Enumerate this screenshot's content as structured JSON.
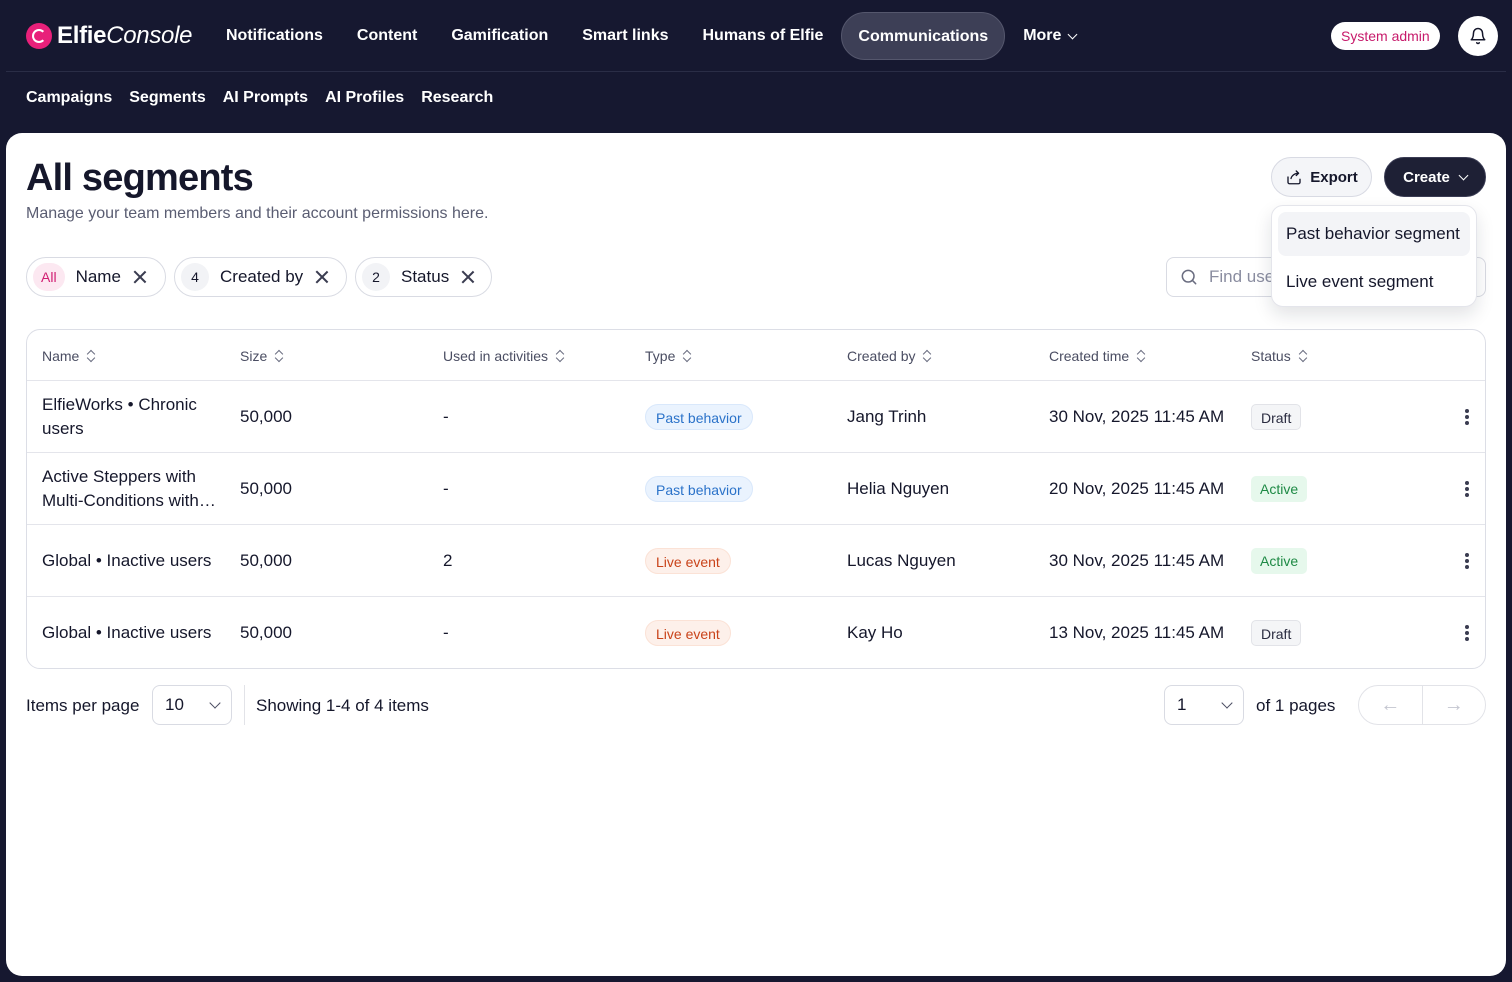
{
  "app": {
    "logo_bold": "Elfie",
    "logo_italic": "Console",
    "nav": [
      "Notifications",
      "Content",
      "Gamification",
      "Smart links",
      "Humans of Elfie",
      "Communications"
    ],
    "nav_active": "Communications",
    "nav_more": "More",
    "role": "System admin",
    "subnav": [
      "Campaigns",
      "Segments",
      "AI Prompts",
      "AI Profiles",
      "Research"
    ]
  },
  "page": {
    "title": "All segments",
    "subtitle": "Manage your team members and their account permissions here.",
    "export_label": "Export",
    "create_label": "Create",
    "create_menu": [
      "Past behavior segment",
      "Live event segment"
    ]
  },
  "filters": [
    {
      "badge": "All",
      "label": "Name"
    },
    {
      "badge": "4",
      "label": "Created by"
    },
    {
      "badge": "2",
      "label": "Status"
    }
  ],
  "search": {
    "placeholder": "Find users"
  },
  "table": {
    "headers": [
      "Name",
      "Size",
      "Used in activities",
      "Type",
      "Created by",
      "Created time",
      "Status"
    ],
    "rows": [
      {
        "name": "ElfieWorks • Chronic users",
        "size": "50,000",
        "used": "-",
        "type": "Past behavior",
        "created_by": "Jang Trinh",
        "created_time": "30 Nov, 2025 11:45 AM",
        "status": "Draft"
      },
      {
        "name": "Active Steppers with Multi-Conditions with filters",
        "size": "50,000",
        "used": "-",
        "type": "Past behavior",
        "created_by": "Helia Nguyen",
        "created_time": "20 Nov, 2025 11:45 AM",
        "status": "Active"
      },
      {
        "name": "Global • Inactive users",
        "size": "50,000",
        "used": "2",
        "type": "Live event",
        "created_by": "Lucas Nguyen",
        "created_time": "30 Nov, 2025 11:45 AM",
        "status": "Active"
      },
      {
        "name": "Global • Inactive users",
        "size": "50,000",
        "used": "-",
        "type": "Live event",
        "created_by": "Kay Ho",
        "created_time": "13 Nov, 2025 11:45 AM",
        "status": "Draft"
      }
    ]
  },
  "pagination": {
    "items_per_page_label": "Items per page",
    "items_per_page": "10",
    "showing": "Showing 1-4 of 4 items",
    "page": "1",
    "of_pages": "of 1 pages",
    "prev": "←",
    "next": "→"
  },
  "colors": {
    "brand": "#e8207a",
    "bg": "#161830",
    "past": "#2a72c9",
    "live": "#c9431a",
    "active": "#1e8a45"
  }
}
